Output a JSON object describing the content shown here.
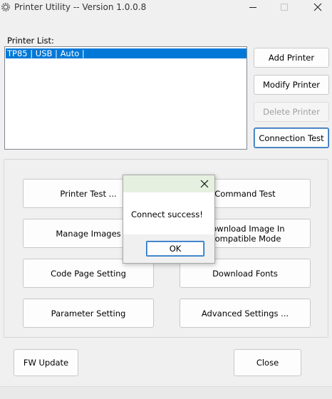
{
  "window": {
    "title": "Printer Utility -- Version 1.0.0.8",
    "icons": {
      "app": "gear-icon",
      "minimize": "minimize-icon",
      "maximize": "maximize-icon",
      "close": "close-icon"
    }
  },
  "printer_list": {
    "label": "Printer List:",
    "items": [
      {
        "text": "TP85 | USB | Auto |",
        "selected": true
      }
    ]
  },
  "side_buttons": {
    "add": "Add Printer",
    "modify": "Modify Printer",
    "delete": "Delete Printer",
    "connection_test": "Connection Test"
  },
  "actions": {
    "printer_test": "Printer Test ...",
    "command_test": "Command Test",
    "manage_images": "Manage Images",
    "download_image_line1": "Download Image In",
    "download_image_line2": "Compatible Mode",
    "code_page": "Code Page Setting",
    "download_fonts": "Download Fonts",
    "parameter_setting": "Parameter Setting",
    "advanced_settings": "Advanced Settings ..."
  },
  "footer": {
    "fw_update": "FW Update",
    "close": "Close"
  },
  "dialog": {
    "message": "Connect success!",
    "ok": "OK"
  },
  "colors": {
    "selection": "#0078d7",
    "dialog_header": "#e6f0e0",
    "focus_border": "#1e6fc4"
  }
}
